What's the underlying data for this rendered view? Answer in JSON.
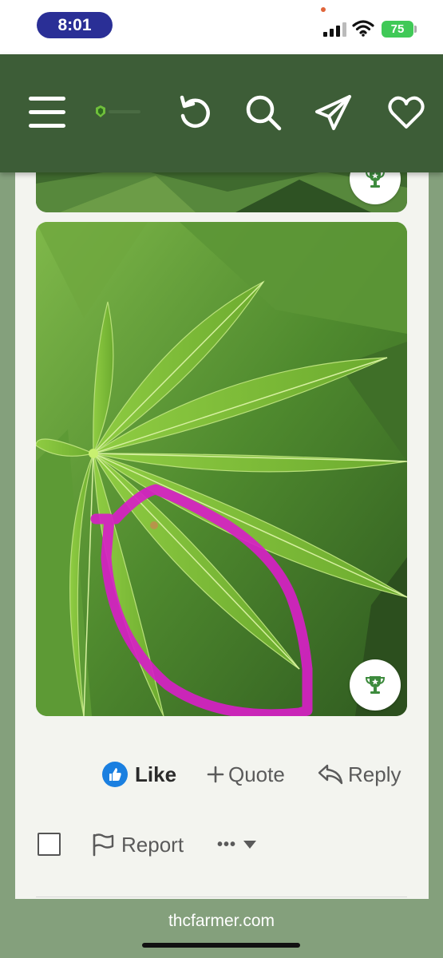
{
  "status_bar": {
    "time": "8:01",
    "battery": "75",
    "icons": [
      "cellular-signal-icon",
      "wifi-icon",
      "battery-charging-icon"
    ]
  },
  "header": {
    "icons": [
      "menu-icon",
      "site-logo",
      "refresh-icon",
      "search-icon",
      "send-icon",
      "heart-icon"
    ],
    "background": "#3d5d37"
  },
  "post": {
    "images": [
      {
        "name": "cannabis-leaf-photo-top",
        "partial": true
      },
      {
        "name": "cannabis-leaf-photo-main",
        "annotation": "magenta freehand circle"
      }
    ],
    "reactions": {
      "like_label": "Like",
      "quote_label": "Quote",
      "reply_label": "Reply"
    },
    "actions": {
      "report_label": "Report",
      "more_label": "•••"
    }
  },
  "url_bar": {
    "domain": "thcfarmer.com"
  },
  "colors": {
    "page_bg": "#84a07c",
    "card_bg": "#f3f4ef",
    "like_blue": "#1a7fe0",
    "trophy_green": "#3d8b3d",
    "annotation_magenta": "#d61fc4"
  }
}
